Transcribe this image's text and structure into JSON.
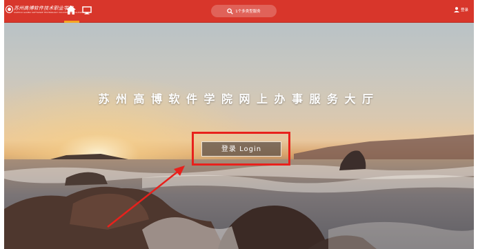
{
  "header": {
    "school_name": "苏州高博软件技术职业学院",
    "school_name_en": "SUZHOU GAOBO SOFTWARE TECHNOLOGY VOCATIONAL COLLEGE",
    "search": {
      "placeholder": "1个多类型服务",
      "icon": "search-icon"
    },
    "user": {
      "label": "登录",
      "icon": "user-icon"
    },
    "nav": [
      {
        "name": "home",
        "icon": "home-icon",
        "active": true
      },
      {
        "name": "desktop",
        "icon": "desktop-icon",
        "active": false
      }
    ]
  },
  "hero": {
    "title": "苏州高博软件学院网上办事服务大厅",
    "login_label": "登录 Login"
  },
  "colors": {
    "topbar": "#d8362b",
    "active_tab_underline": "#f5a623",
    "annotation": "#e8211c"
  }
}
